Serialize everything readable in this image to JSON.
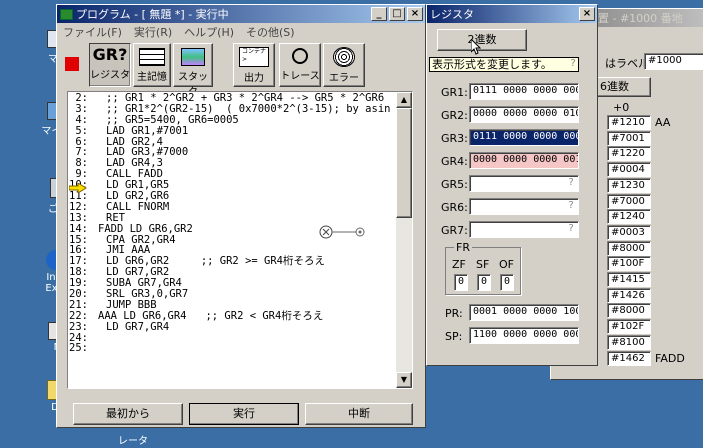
{
  "desktop": {
    "icons": [
      "マイ",
      "マイ ネ",
      "ごみ",
      "Inte Expl",
      "M",
      "Do"
    ],
    "taskbar_label": "レータ"
  },
  "memory_window": {
    "title": "置 - #1000 番地",
    "label_prompt": "はラベル:",
    "label_value": "#1000",
    "format_button": "6進数",
    "offset_header": "+0",
    "rows": [
      {
        "value": "#1210",
        "label": "AA"
      },
      {
        "value": "#7001",
        "label": ""
      },
      {
        "value": "#1220",
        "label": ""
      },
      {
        "value": "#0004",
        "label": ""
      },
      {
        "value": "#1230",
        "label": ""
      },
      {
        "value": "#7000",
        "label": ""
      },
      {
        "value": "#1240",
        "label": ""
      },
      {
        "value": "#0003",
        "label": ""
      },
      {
        "value": "#8000",
        "label": ""
      },
      {
        "value": "#100F",
        "label": ""
      },
      {
        "value": "#1415",
        "label": ""
      },
      {
        "value": "#1426",
        "label": ""
      },
      {
        "value": "#8000",
        "label": ""
      },
      {
        "value": "#102F",
        "label": ""
      },
      {
        "value": "#8100",
        "label": ""
      },
      {
        "value": "#1462",
        "label": "FADD"
      }
    ]
  },
  "program_window": {
    "title": "プログラム - [ 無題 *] - 実行中",
    "menu": [
      "ファイル(F)",
      "実行(R)",
      "ヘルプ(H)",
      "その他(S)"
    ],
    "toolbar": {
      "register_glyph": "GR?",
      "register": "レジスタ",
      "memory": "主記憶",
      "stack": "スタック",
      "output_glyph": "コンテナ\n>",
      "output": "出力",
      "trace": "トレース",
      "error": "エラー"
    },
    "line_numbers": [
      "2:",
      "3:",
      "4:",
      "5:",
      "6:",
      "7:",
      "8:",
      "9:",
      "10:",
      "11:",
      "12:",
      "13:",
      "14:",
      "15:",
      "16:",
      "17:",
      "18:",
      "19:",
      "20:",
      "21:",
      "22:",
      "23:",
      "24:",
      "25:"
    ],
    "code_lines": [
      ";; GR1 * 2^GR2 + GR3 * 2^GR4 --> GR5 * 2^GR6",
      ";; GR1*2^(GR2-15)  ( 0x7000*2^(3-15); by asin",
      ";; GR5=5400, GR6=0005",
      "LAD GR1,#7001",
      "LAD GR2,4",
      "LAD GR3,#7000",
      "LAD GR4,3",
      "CALL FADD",
      "LD GR1,GR5",
      "LD GR2,GR6",
      "CALL FNORM",
      "RET",
      "FADD LD GR6,GR2",
      "CPA GR2,GR4",
      "JMI AAA",
      "LD GR6,GR2     ;; GR2 >= GR4桁そろえ",
      "LD GR7,GR2",
      "SUBA GR7,GR4",
      "SRL GR3,0,GR7",
      "JUMP BBB",
      "AAA LD GR6,GR4   ;; GR2 < GR4桁そろえ",
      "LD GR7,GR4",
      "",
      ""
    ],
    "current_line": 9,
    "buttons": {
      "start": "最初から",
      "run": "実行",
      "stop": "中断"
    }
  },
  "register_window": {
    "title": "レジスタ",
    "format_button": "2進数",
    "tooltip": "表示形式を変更します。",
    "tooltip_q": "?",
    "registers": [
      {
        "name": "GR1:",
        "value": "0111 0000 0000 0001",
        "state": "normal"
      },
      {
        "name": "GR2:",
        "value": "0000 0000 0000 0100",
        "state": "normal"
      },
      {
        "name": "GR3:",
        "value": "0111 0000 0000 0000",
        "state": "selected"
      },
      {
        "name": "GR4:",
        "value": "0000 0000 0000 0011",
        "state": "changed"
      },
      {
        "name": "GR5:",
        "value": "?",
        "state": "unknown"
      },
      {
        "name": "GR6:",
        "value": "?",
        "state": "unknown"
      },
      {
        "name": "GR7:",
        "value": "?",
        "state": "unknown"
      }
    ],
    "fr": {
      "title": "FR",
      "labels": [
        "ZF",
        "SF",
        "OF"
      ],
      "values": [
        "0",
        "0",
        "0"
      ]
    },
    "pr": {
      "name": "PR:",
      "value": "0001 0000 0000 1000"
    },
    "sp": {
      "name": "SP:",
      "value": "1100 0000 0000 0000"
    }
  },
  "colors": {
    "selected": "#0a246a",
    "changed": "#f4c6c6",
    "title": "#0a246a"
  }
}
